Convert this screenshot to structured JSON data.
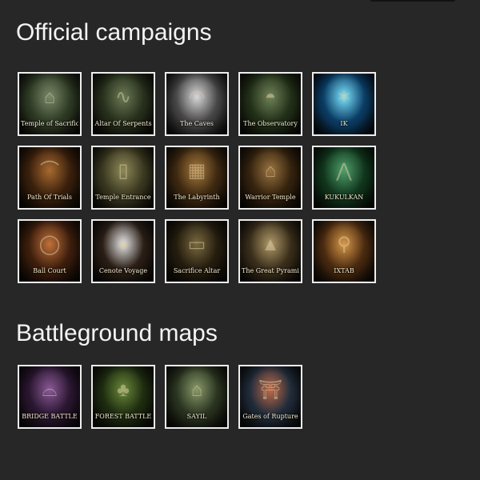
{
  "sections": [
    {
      "title": "Official campaigns",
      "tiles": [
        {
          "label": "Temple of Sacrifice",
          "icon": "temple-icon",
          "glyph": "⌂",
          "c1": "#7a8a6a",
          "c2": "#2e3a24"
        },
        {
          "label": "Altar Of Serpents",
          "icon": "serpent-altar-icon",
          "glyph": "∿",
          "c1": "#6b7a55",
          "c2": "#27301c"
        },
        {
          "label": "The Caves",
          "icon": "cave-icon",
          "glyph": "◠",
          "c1": "#d8d8d8",
          "c2": "#474747"
        },
        {
          "label": "The Observatory",
          "icon": "observatory-icon",
          "glyph": "◓",
          "c1": "#6f8258",
          "c2": "#223018"
        },
        {
          "label": "IK",
          "icon": "ik-creature-icon",
          "glyph": "✶",
          "c1": "#7de6ff",
          "c2": "#0a3d66"
        },
        {
          "label": "Path Of Trials",
          "icon": "path-icon",
          "glyph": "⌒",
          "c1": "#a86a30",
          "c2": "#3a200c"
        },
        {
          "label": "Temple Entrance",
          "icon": "entrance-icon",
          "glyph": "▯",
          "c1": "#8f8a5a",
          "c2": "#3a3820"
        },
        {
          "label": "The Labyrinth",
          "icon": "labyrinth-icon",
          "glyph": "▦",
          "c1": "#a77a3e",
          "c2": "#3d2810"
        },
        {
          "label": "Warrior Temple",
          "icon": "warrior-temple-icon",
          "glyph": "⌂",
          "c1": "#9a7440",
          "c2": "#35230e"
        },
        {
          "label": "KUKULKAN",
          "icon": "kukulkan-icon",
          "glyph": "⋀",
          "c1": "#4fa06c",
          "c2": "#10361c"
        },
        {
          "label": "Ball Court",
          "icon": "ball-court-icon",
          "glyph": "◯",
          "c1": "#c0703a",
          "c2": "#3d1e0c"
        },
        {
          "label": "Cenote Voyage",
          "icon": "cenote-icon",
          "glyph": "●",
          "c1": "#e6e6e6",
          "c2": "#2a1e16"
        },
        {
          "label": "Sacrifice Altar",
          "icon": "sacrifice-altar-icon",
          "glyph": "▭",
          "c1": "#7a6a40",
          "c2": "#241c0e"
        },
        {
          "label": "The Great Pyramid",
          "icon": "pyramid-icon",
          "glyph": "▲",
          "c1": "#b09a6a",
          "c2": "#3a2e1a"
        },
        {
          "label": "IXTAB",
          "icon": "ixtab-icon",
          "glyph": "⚲",
          "c1": "#d89848",
          "c2": "#4a2a10"
        }
      ]
    },
    {
      "title": "Battleground maps",
      "tiles": [
        {
          "label": "BRIDGE BATTLE",
          "icon": "bridge-icon",
          "glyph": "⌓",
          "c1": "#8a5a96",
          "c2": "#2a1630"
        },
        {
          "label": "FOREST BATTLE",
          "icon": "forest-icon",
          "glyph": "♣",
          "c1": "#6a8a3a",
          "c2": "#1e2c10"
        },
        {
          "label": "SAYIL",
          "icon": "sayil-icon",
          "glyph": "⌂",
          "c1": "#8a9a6a",
          "c2": "#2a3420"
        },
        {
          "label": "Gates of Rupture",
          "icon": "gates-icon",
          "glyph": "⛩",
          "c1": "#c06a4a",
          "c2": "#202c3a"
        }
      ]
    }
  ]
}
